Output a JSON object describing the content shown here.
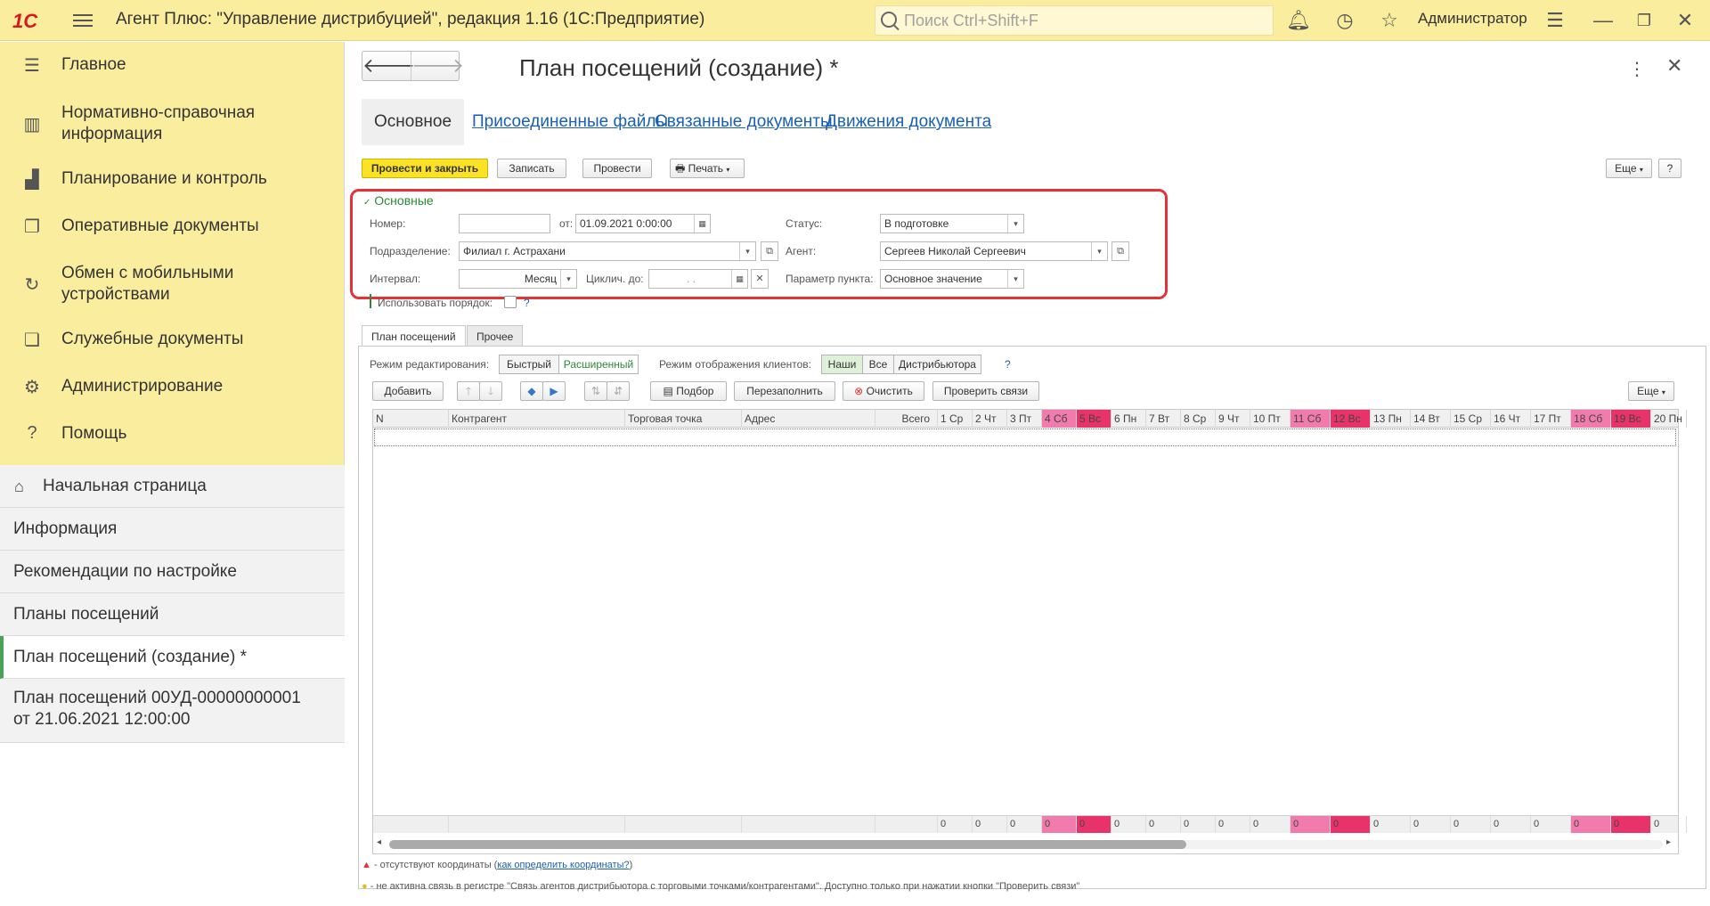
{
  "app": {
    "logo": "1С",
    "title": "Агент Плюс: \"Управление дистрибуцией\", редакция 1.16  (1С:Предприятие)",
    "search_placeholder": "Поиск Ctrl+Shift+F",
    "user": "Администратор"
  },
  "sidebar": {
    "items": [
      {
        "icon": "list-icon",
        "glyph": "☰",
        "label": "Главное"
      },
      {
        "icon": "books-icon",
        "glyph": "▥",
        "label": "Нормативно-справочная\nинформация"
      },
      {
        "icon": "chart-icon",
        "glyph": "▟",
        "label": "Планирование и контроль"
      },
      {
        "icon": "documents-icon",
        "glyph": "❐",
        "label": "Оперативные документы"
      },
      {
        "icon": "sync-icon",
        "glyph": "↻",
        "label": "Обмен с мобильными\nустройствами"
      },
      {
        "icon": "service-docs-icon",
        "glyph": "❏",
        "label": "Служебные документы"
      },
      {
        "icon": "gear-icon",
        "glyph": "⚙",
        "label": "Администрирование"
      },
      {
        "icon": "help-icon",
        "glyph": "?",
        "label": "Помощь"
      }
    ],
    "open_windows": [
      {
        "label": "Начальная страница"
      },
      {
        "label": "Информация"
      },
      {
        "label": "Рекомендации по настройке"
      },
      {
        "label": "Планы посещений"
      },
      {
        "label": "План посещений  (создание) *"
      },
      {
        "label": "План посещений 00УД-00000000001\nот 21.06.2021 12:00:00"
      }
    ]
  },
  "form": {
    "title": "План посещений  (создание) *",
    "tabs": [
      "Основное",
      "Присоединенные файлы",
      "Связанные документы",
      "Движения документа"
    ],
    "toolbar": {
      "post_close": "Провести и закрыть",
      "save": "Записать",
      "post": "Провести",
      "print": "Печать",
      "more": "Еще",
      "help": "?"
    },
    "group": {
      "title": "Основные",
      "number_label": "Номер:",
      "number_value": "",
      "date_label": "от:",
      "date_value": "01.09.2021  0:00:00",
      "status_label": "Статус:",
      "status_value": "В подготовке",
      "division_label": "Подразделение:",
      "division_value": "Филиал г. Астрахани",
      "agent_label": "Агент:",
      "agent_value": "Сергеев Николай Сергеевич",
      "interval_label": "Интервал:",
      "interval_value": "Месяц",
      "cyclic_label": "Циклич. до:",
      "cyclic_value": " .  .    ",
      "param_label": "Параметр пункта:",
      "param_value": "Основное значение",
      "use_order_label": "Использовать порядок:",
      "help": "?"
    },
    "lower_tabs": [
      "План посещений",
      "Прочее"
    ],
    "edit_mode_label": "Режим редактирования:",
    "edit_modes": [
      "Быстрый",
      "Расширенный"
    ],
    "display_mode_label": "Режим отображения клиентов:",
    "display_modes": [
      "Наши",
      "Все",
      "Дистрибьютора"
    ],
    "display_help": "?",
    "table_toolbar": {
      "add": "Добавить",
      "pick": "Подбор",
      "refill": "Перезаполнить",
      "clear": "Очистить",
      "check": "Проверить связи",
      "more": "Еще"
    },
    "columns": [
      "N",
      "Контрагент",
      "Торговая точка",
      "Адрес",
      "Всего"
    ],
    "days": [
      {
        "label": "1 Ср",
        "kind": ""
      },
      {
        "label": "2 Чт",
        "kind": ""
      },
      {
        "label": "3 Пт",
        "kind": ""
      },
      {
        "label": "4 Сб",
        "kind": "pink"
      },
      {
        "label": "5 Вс",
        "kind": "red"
      },
      {
        "label": "6 Пн",
        "kind": ""
      },
      {
        "label": "7 Вт",
        "kind": ""
      },
      {
        "label": "8 Ср",
        "kind": ""
      },
      {
        "label": "9 Чт",
        "kind": ""
      },
      {
        "label": "10 Пт",
        "kind": ""
      },
      {
        "label": "11 Сб",
        "kind": "pink"
      },
      {
        "label": "12 Вс",
        "kind": "red"
      },
      {
        "label": "13 Пн",
        "kind": ""
      },
      {
        "label": "14 Вт",
        "kind": ""
      },
      {
        "label": "15 Ср",
        "kind": ""
      },
      {
        "label": "16 Чт",
        "kind": ""
      },
      {
        "label": "17 Пт",
        "kind": ""
      },
      {
        "label": "18 Сб",
        "kind": "pink"
      },
      {
        "label": "19 Вс",
        "kind": "red"
      },
      {
        "label": "20 Пн",
        "kind": ""
      }
    ],
    "footer_totals": [
      "0",
      "0",
      "0",
      "0",
      "0",
      "0",
      "0",
      "0",
      "0",
      "0",
      "0",
      "0",
      "0",
      "0",
      "0",
      "0",
      "0",
      "0",
      "0",
      "0"
    ],
    "legend": {
      "no_coords": "- отсутствуют координаты (",
      "no_coords_link": "как определить координаты?",
      "no_coords_end": ")",
      "inactive_link": "- не активна связь в регистре \"Связь агентов дистрибьютора с торговыми точками/контрагентами\". Доступно только при нажатии кнопки \"Проверить связи\""
    }
  }
}
